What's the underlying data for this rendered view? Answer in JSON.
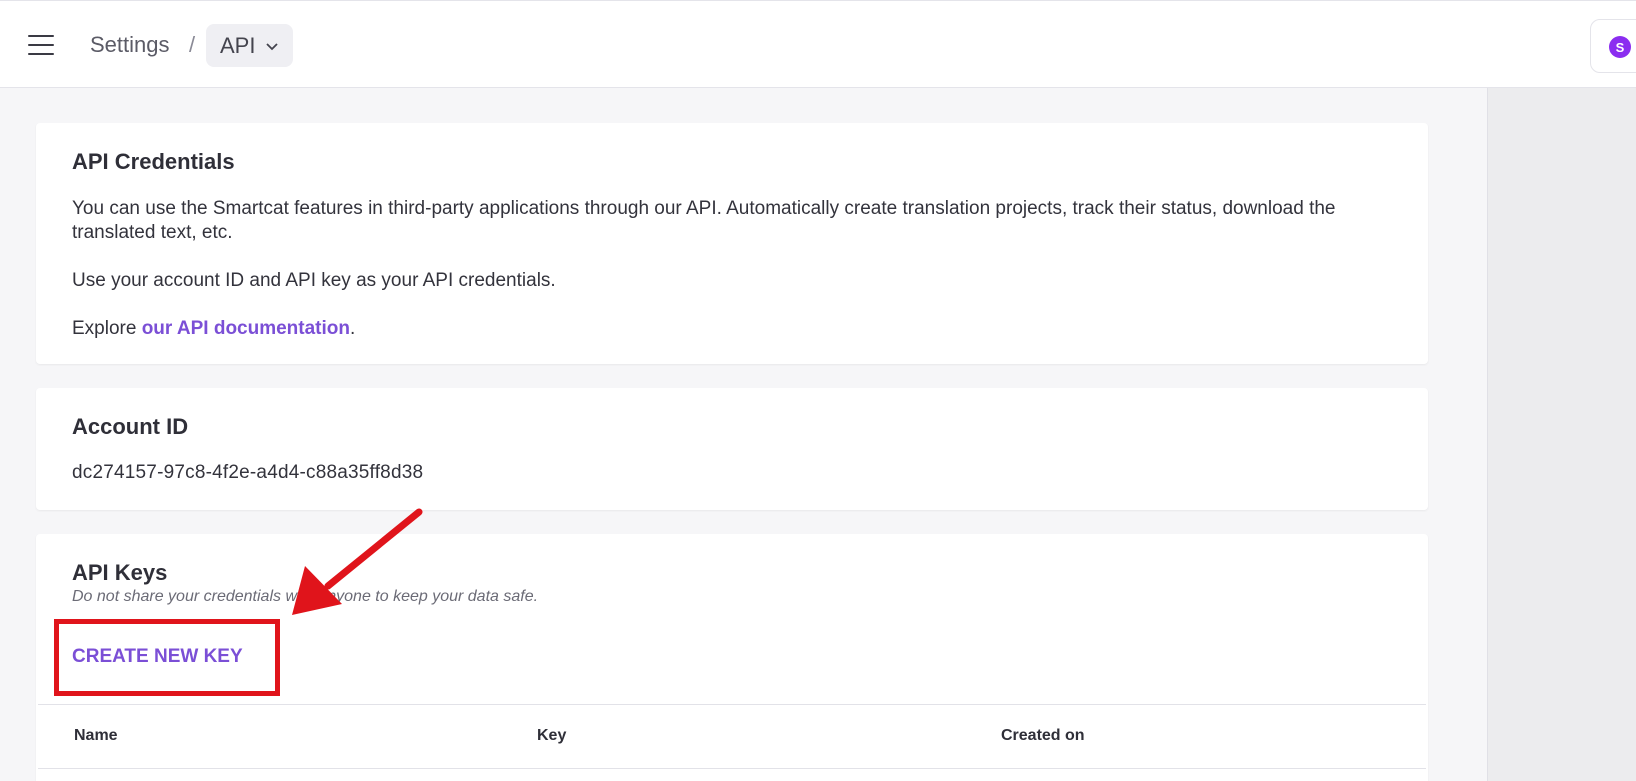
{
  "header": {
    "breadcrumb_root": "Settings",
    "breadcrumb_separator": "/",
    "breadcrumb_current": "API",
    "avatar_initial": "S"
  },
  "credentials": {
    "title": "API Credentials",
    "description": "You can use the Smartcat features in third-party applications through our API. Automatically create translation projects, track their status, download the translated text, etc.",
    "credentials_hint": "Use your account ID and API key as your API credentials.",
    "explore_prefix": "Explore ",
    "docs_link": "our API documentation",
    "explore_suffix": "."
  },
  "account": {
    "title": "Account ID",
    "id": "dc274157-97c8-4f2e-a4d4-c88a35ff8d38"
  },
  "api_keys": {
    "title": "API Keys",
    "note": "Do not share your credentials with anyone to keep your data safe.",
    "create_button": "CREATE NEW KEY",
    "columns": [
      "Name",
      "Key",
      "Created on"
    ]
  },
  "colors": {
    "accent": "#7b4fd6",
    "annotation": "#e0141b",
    "avatar": "#8b2df0"
  }
}
